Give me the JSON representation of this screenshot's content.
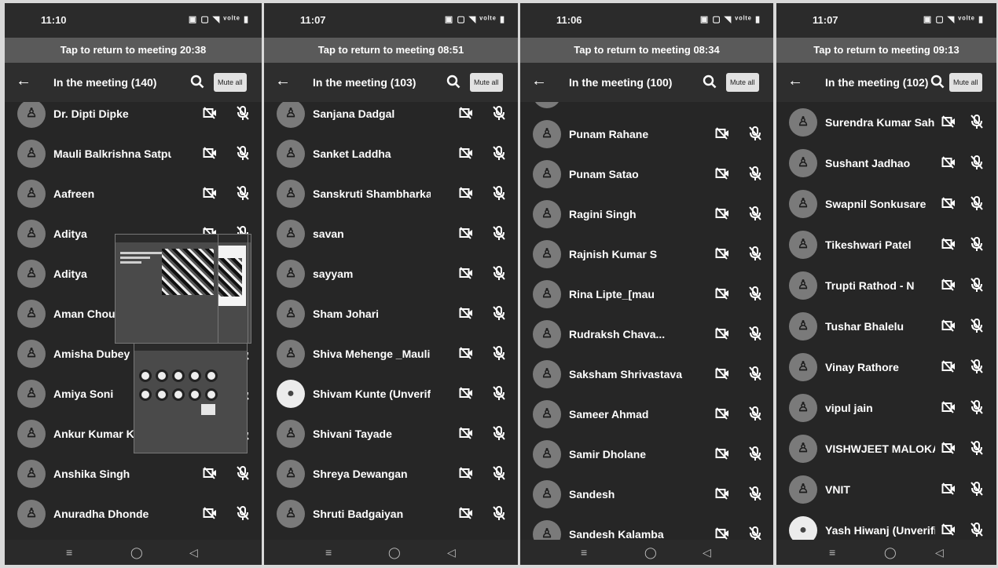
{
  "screens": [
    {
      "status_time": "11:10",
      "status_icons": "▣ ▢ ◥ ᵛᵒˡᵗᵉ ▮",
      "return_text": "Tap to return to meeting 20:38",
      "title": "In the meeting (140)",
      "mute_all": "Mute all",
      "participants": [
        {
          "name": "Dr. Dipti Dipke",
          "avatar": "person"
        },
        {
          "name": "Mauli Balkrishna Satpu...",
          "avatar": "person"
        },
        {
          "name": "Aafreen",
          "avatar": "person"
        },
        {
          "name": "Aditya",
          "avatar": "person"
        },
        {
          "name": "Aditya",
          "avatar": "person"
        },
        {
          "name": "Aman Choudhary",
          "avatar": "person"
        },
        {
          "name": "Amisha Dubey",
          "avatar": "person"
        },
        {
          "name": "Amiya Soni",
          "avatar": "person"
        },
        {
          "name": "Ankur Kumar Ka",
          "avatar": "person"
        },
        {
          "name": "Anshika Singh",
          "avatar": "person"
        },
        {
          "name": "Anuradha Dhonde",
          "avatar": "person"
        }
      ]
    },
    {
      "status_time": "11:07",
      "status_icons": "▣ ▢ ◥ ᵛᵒˡᵗᵉ ▮",
      "return_text": "Tap to return to meeting 08:51",
      "title": "In the meeting (103)",
      "mute_all": "Mute all",
      "participants": [
        {
          "name": "Sanjana Dadgal",
          "avatar": "person"
        },
        {
          "name": "Sanket Laddha",
          "avatar": "person"
        },
        {
          "name": "Sanskruti Shambharkar",
          "avatar": "person"
        },
        {
          "name": "savan",
          "avatar": "person"
        },
        {
          "name": "sayyam",
          "avatar": "person"
        },
        {
          "name": "Sham Johari",
          "avatar": "person"
        },
        {
          "name": "Shiva Mehenge _Mauli ...",
          "avatar": "person"
        },
        {
          "name": "Shivam Kunte (Unverifi...",
          "avatar": "light"
        },
        {
          "name": "Shivani Tayade",
          "avatar": "person"
        },
        {
          "name": "Shreya Dewangan",
          "avatar": "person"
        },
        {
          "name": "Shruti Badgaiyan",
          "avatar": "person"
        }
      ]
    },
    {
      "status_time": "11:06",
      "status_icons": "▣ ▢ ◥ ᵛᵒˡᵗᵉ ▮",
      "return_text": "Tap to return to meeting 08:34",
      "title": "In the meeting (100)",
      "mute_all": "Mute all",
      "participants": [
        {
          "name": "praveen mishra",
          "avatar": "person"
        },
        {
          "name": "Punam Rahane",
          "avatar": "person"
        },
        {
          "name": "Punam Satao",
          "avatar": "person"
        },
        {
          "name": "Ragini Singh",
          "avatar": "person"
        },
        {
          "name": "Rajnish Kumar S",
          "avatar": "person"
        },
        {
          "name": "Rina Lipte_[mau",
          "avatar": "person"
        },
        {
          "name": "Rudraksh Chava...",
          "avatar": "person"
        },
        {
          "name": "Saksham Shrivastava",
          "avatar": "person"
        },
        {
          "name": "Sameer Ahmad",
          "avatar": "person"
        },
        {
          "name": "Samir Dholane",
          "avatar": "person"
        },
        {
          "name": "Sandesh",
          "avatar": "person"
        },
        {
          "name": "Sandesh Kalamba",
          "avatar": "person"
        }
      ]
    },
    {
      "status_time": "11:07",
      "status_icons": "▣ ▢ ◥ ᵛᵒˡᵗᵉ ▮",
      "return_text": "Tap to return to meeting 09:13",
      "title": "In the meeting (102)",
      "mute_all": "Mute all",
      "participants": [
        {
          "name": "Surendra Kumar Sahu",
          "avatar": "person"
        },
        {
          "name": "Sushant Jadhao",
          "avatar": "person"
        },
        {
          "name": "Swapnil Sonkusare",
          "avatar": "person"
        },
        {
          "name": "Tikeshwari Patel",
          "avatar": "person"
        },
        {
          "name": "Trupti Rathod - N",
          "avatar": "person"
        },
        {
          "name": "Tushar Bhalelu",
          "avatar": "person"
        },
        {
          "name": "Vinay Rathore",
          "avatar": "person"
        },
        {
          "name": "vipul jain",
          "avatar": "person"
        },
        {
          "name": "VISHWJEET MALOKAR",
          "avatar": "person"
        },
        {
          "name": "VNIT",
          "avatar": "person"
        },
        {
          "name": "Yash Hiwanj (Unverified)",
          "avatar": "light"
        }
      ]
    }
  ],
  "icons": {
    "back": "arrow-left-icon",
    "search": "search-icon",
    "video": "video-off-icon",
    "mic": "mic-off-icon",
    "nav": [
      "recents-icon",
      "home-icon",
      "back-nav-icon"
    ]
  },
  "colors": {
    "background": "#262626",
    "header": "#2e2e2e",
    "return_bar": "#5a5a5a",
    "text": "#ffffff",
    "mute_button": "#e2e2e2"
  }
}
